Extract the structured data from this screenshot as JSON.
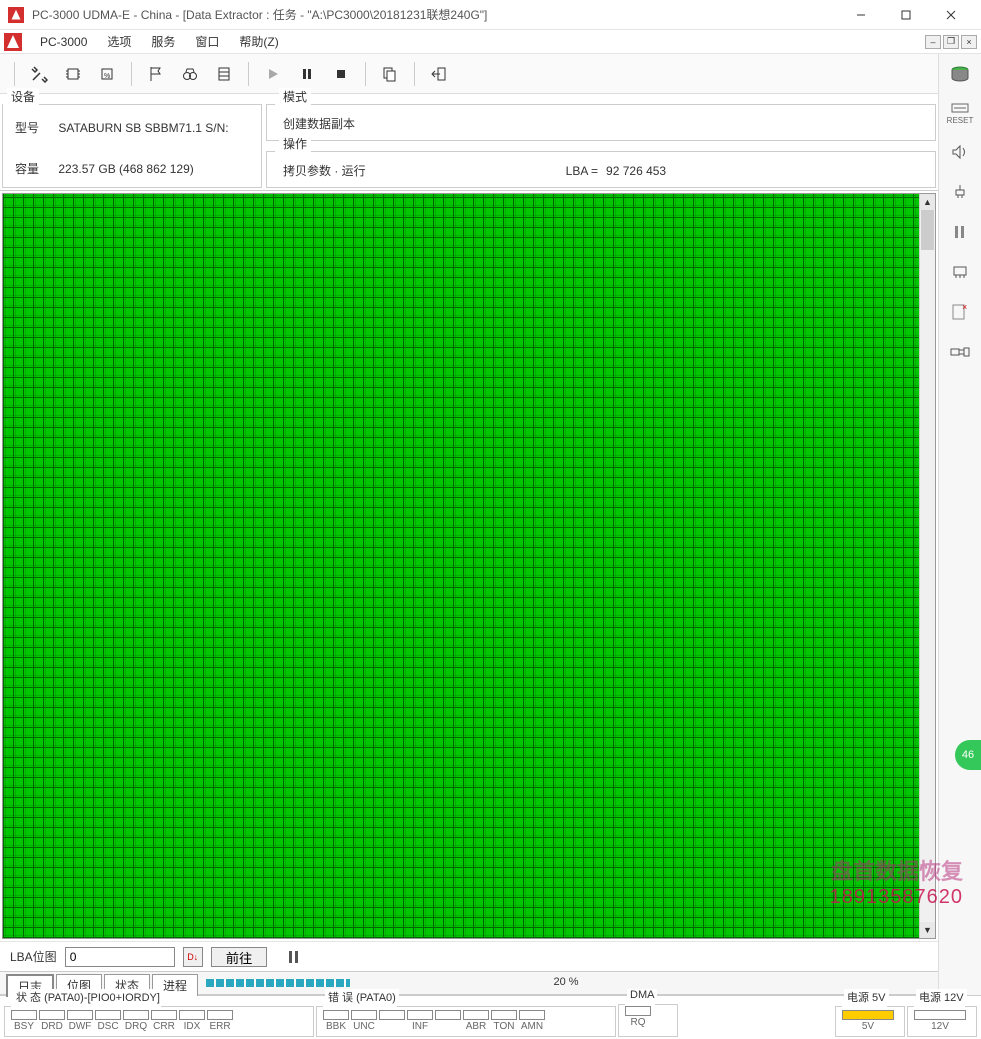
{
  "window": {
    "title": "PC-3000 UDMA-E - China - [Data Extractor : 任务 - \"A:\\PC3000\\20181231联想240G\"]"
  },
  "menu": {
    "app": "PC-3000",
    "items": [
      "选项",
      "服务",
      "窗口",
      "帮助(Z)"
    ]
  },
  "device_panel": {
    "legend": "设备",
    "model_lbl": "型号",
    "model_val": "SATABURN  SB SBBM71.1 S/N:",
    "capacity_lbl": "容量",
    "capacity_val": "223.57 GB (468 862 129)"
  },
  "mode_panel": {
    "legend": "模式",
    "value": "创建数据副本"
  },
  "op_panel": {
    "legend": "操作",
    "value": "拷贝参数 · 运行",
    "lba_lbl": "LBA  =",
    "lba_val": "92 726 453"
  },
  "lba_nav": {
    "label": "LBA位图",
    "value": "0",
    "go": "前往"
  },
  "tabs": {
    "items": [
      "日志",
      "位图",
      "状态",
      "进程"
    ],
    "active": 0,
    "progress_percent": 20,
    "progress_text": "20 %"
  },
  "status": {
    "pata_label": "状 态 (PATA0)-[PIO0+IORDY]",
    "pata_items": [
      "BSY",
      "DRD",
      "DWF",
      "DSC",
      "DRQ",
      "CRR",
      "IDX",
      "ERR"
    ],
    "err_label": "错 误 (PATA0)",
    "err_items": [
      "BBK",
      "UNC",
      "",
      "INF",
      "",
      "ABR",
      "TON",
      "AMN"
    ],
    "dma_label": "DMA",
    "dma_items": [
      "RQ"
    ],
    "pwr5_label": "电源 5V",
    "pwr5_items": [
      "5V"
    ],
    "pwr12_label": "电源 12V",
    "pwr12_items": [
      "12V"
    ]
  },
  "side_labels": {
    "reset": "RESET"
  },
  "watermark": {
    "line1": "盘首数据恢复",
    "line2": "18913587620"
  },
  "badge": "46"
}
